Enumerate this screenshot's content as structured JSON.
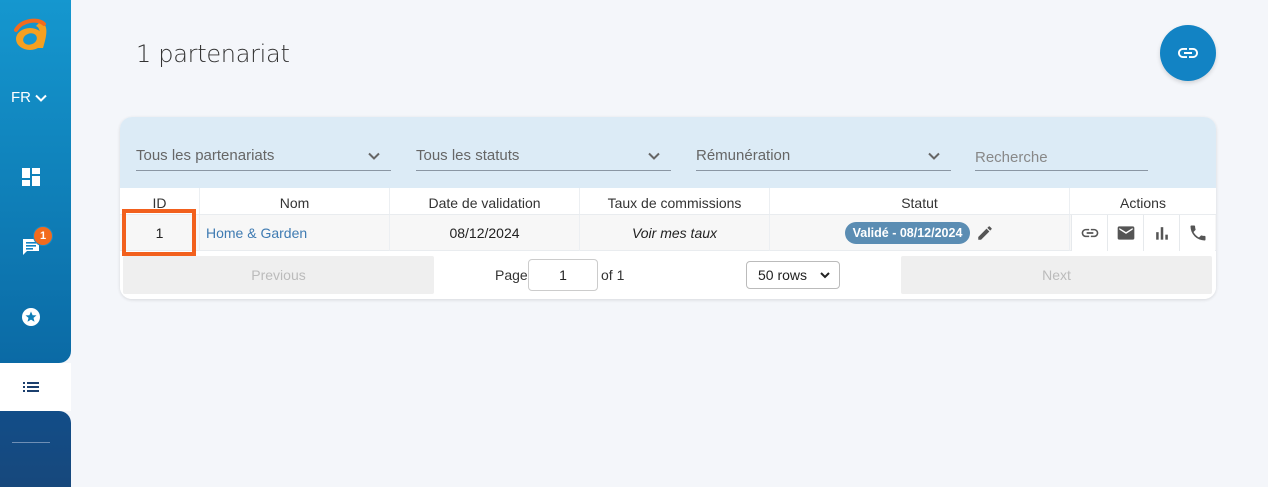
{
  "sidebar": {
    "language": "FR",
    "notifications_count": "1",
    "items": [
      {
        "name": "dashboard",
        "icon": "dashboard-icon"
      },
      {
        "name": "messages",
        "icon": "chat-icon"
      },
      {
        "name": "favorites",
        "icon": "star-circle-icon"
      },
      {
        "name": "list",
        "icon": "list-icon"
      }
    ]
  },
  "header": {
    "title": "1 partenariat"
  },
  "filters": {
    "partnerships": "Tous les partenariats",
    "statuses": "Tous les statuts",
    "remuneration": "Rémunération",
    "search_placeholder": "Recherche"
  },
  "table": {
    "columns": [
      "ID",
      "Nom",
      "Date de validation",
      "Taux de commissions",
      "Statut",
      "Actions"
    ],
    "rows": [
      {
        "id": "1",
        "name": "Home & Garden",
        "validation_date": "08/12/2024",
        "commission": "Voir mes taux",
        "status": "Validé - 08/12/2024"
      }
    ]
  },
  "pagination": {
    "previous": "Previous",
    "next": "Next",
    "page_label": "Page",
    "page_value": "1",
    "of_label": "of 1",
    "rows_option": "50 rows"
  },
  "colors": {
    "brand": "#1283c4",
    "highlight": "#f2601d",
    "status": "#5b8db3",
    "badge": "#f26b1d"
  }
}
